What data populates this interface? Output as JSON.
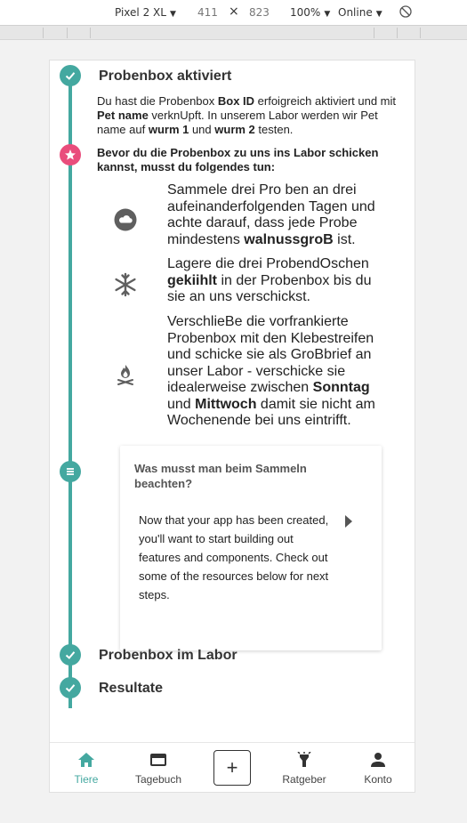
{
  "devtools": {
    "device": "Pixel 2 XL",
    "width": "411",
    "times": "×",
    "height": "823",
    "zoom": "100%",
    "network": "Online"
  },
  "timeline": {
    "step1": {
      "title": "Probenbox aktiviert",
      "p1": "Du hast die Probenbox ",
      "b1": "Box ID",
      "p2": " erfoigreich aktiviert und mit ",
      "b2": "Pet name",
      "p3": " verknUpft. In unserem Labor werden wir Pet name auf ",
      "b3": "wurm 1",
      "p4": " und ",
      "b4": "wurm 2",
      "p5": " testen."
    },
    "warning": "Bevor du die Probenbox zu uns ins Labor schicken kannst, musst du folgendes tun:",
    "instructions": [
      {
        "icon": "cloud-icon",
        "pre": "Sammele drei Pro ben an drei aufeinanderfolgenden Tagen und achte darauf, dass jede Probe mindestens ",
        "bold": "walnussgroB",
        "post": " ist."
      },
      {
        "icon": "snowflake-icon",
        "pre": "Lagere die drei ProbendOschen ",
        "bold": "gekiihlt",
        "post": " in der Probenbox bis du sie an uns verschickst."
      },
      {
        "icon": "campfire-icon",
        "pre": "VerschlieBe die vorfrankierte Probenbox mit den Klebestreifen und schicke sie als GroBbrief an unser Labor - verschicke sie idealerweise zwischen ",
        "bold": "Sonntag",
        "mid": " und ",
        "bold2": "Mittwoch",
        "post": " damit sie nicht am Wochenende bei uns eintrifft."
      }
    ],
    "card": {
      "title": "Was musst man beim Sammeln beachten?",
      "body": "Now that your app has been created, you'll want to start building out features and components. Check out some of the resources below for next steps."
    },
    "step3": {
      "title": "Probenbox im Labor"
    },
    "step4": {
      "title": "Resultate"
    }
  },
  "nav": {
    "items": [
      {
        "label": "Tiere",
        "icon": "home-icon",
        "active": true
      },
      {
        "label": "Tagebuch",
        "icon": "credit-card-icon"
      },
      {
        "label": "+",
        "icon": "add-icon"
      },
      {
        "label": "Ratgeber",
        "icon": "flashlight-icon"
      },
      {
        "label": "Konto",
        "icon": "person-icon"
      }
    ]
  },
  "colors": {
    "accent": "#44a8a0",
    "alert": "#e94d7c"
  }
}
